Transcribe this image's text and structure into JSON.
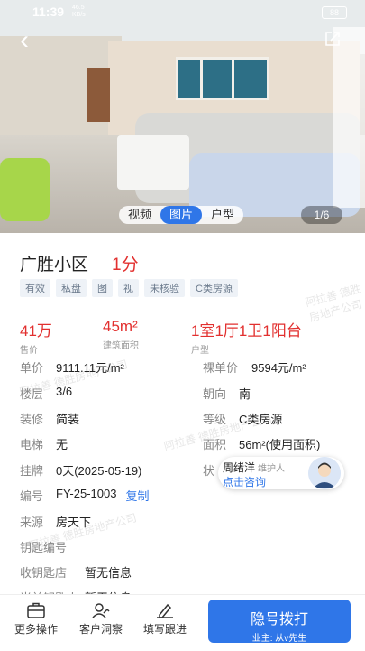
{
  "status_bar": {
    "time": "11:39",
    "net_speed": "46.5 KB/s",
    "battery": "88"
  },
  "media": {
    "tabs": [
      "视频",
      "图片",
      "户型"
    ],
    "active_tab": 1,
    "counter": "1/6"
  },
  "listing": {
    "title": "广胜小区",
    "score": "1分",
    "tags": [
      "有效",
      "私盘",
      "图",
      "视",
      "未核验",
      "C类房源"
    ],
    "kpis": [
      {
        "value": "41万",
        "label": "售价"
      },
      {
        "value": "45m²",
        "label": "建筑面积"
      },
      {
        "value": "1室1厅1卫1阳台",
        "label": "户型"
      }
    ],
    "details_left": [
      {
        "key": "单价",
        "value": "9111.11元/m²"
      },
      {
        "key": "楼层",
        "value": "3/6"
      },
      {
        "key": "装修",
        "value": "简装"
      },
      {
        "key": "电梯",
        "value": "无"
      },
      {
        "key": "挂牌",
        "value": "0天(2025-05-19)"
      },
      {
        "key": "编号",
        "value": "FY-25-1003"
      },
      {
        "key": "来源",
        "value": "房天下"
      },
      {
        "key": "钥匙编号",
        "value": ""
      },
      {
        "key": "收钥匙店",
        "value": "暂无信息"
      },
      {
        "key": "当前钥匙人",
        "value": "暂无信息"
      }
    ],
    "details_right": [
      {
        "key": "裸单价",
        "value": "9594元/m²"
      },
      {
        "key": "朝向",
        "value": "南"
      },
      {
        "key": "等级",
        "value": "C类房源"
      },
      {
        "key": "面积",
        "value": "56m²(使用面积)"
      },
      {
        "key": "状",
        "value": ""
      }
    ],
    "copy_label": "复制"
  },
  "agent": {
    "name": "周绪洋",
    "role": "维护人",
    "action": "点击咨询"
  },
  "bottom_bar": {
    "buttons": [
      "更多操作",
      "客户洞察",
      "填写跟进"
    ],
    "call_title": "隐号拨打",
    "call_sub": "业主: 从v先生"
  },
  "watermark_text": "阿拉善 德胜房地产公司",
  "colors": {
    "accent": "#2f76e8",
    "price": "#e2302f"
  }
}
